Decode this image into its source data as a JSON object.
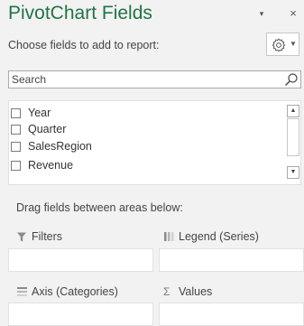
{
  "pane": {
    "title": "PivotChart Fields",
    "dropdown_glyph": "▾",
    "close_glyph": "×",
    "choose_label": "Choose fields to add to report:",
    "gear_icon": "gear-icon",
    "accent_color": "#217346"
  },
  "search": {
    "placeholder": "Search",
    "value": ""
  },
  "fields": [
    {
      "label": "Year",
      "checked": false
    },
    {
      "label": "Quarter",
      "checked": false
    },
    {
      "label": "SalesRegion",
      "checked": false
    },
    {
      "label": "Revenue",
      "checked": false
    }
  ],
  "areas": {
    "drag_label": "Drag fields between areas below:",
    "filters": {
      "label": "Filters",
      "icon": "filter-icon"
    },
    "legend": {
      "label": "Legend (Series)",
      "icon": "columns-icon"
    },
    "axis": {
      "label": "Axis (Categories)",
      "icon": "rows-icon"
    },
    "values": {
      "label": "Values",
      "icon": "sigma-icon",
      "glyph": "Σ"
    }
  }
}
